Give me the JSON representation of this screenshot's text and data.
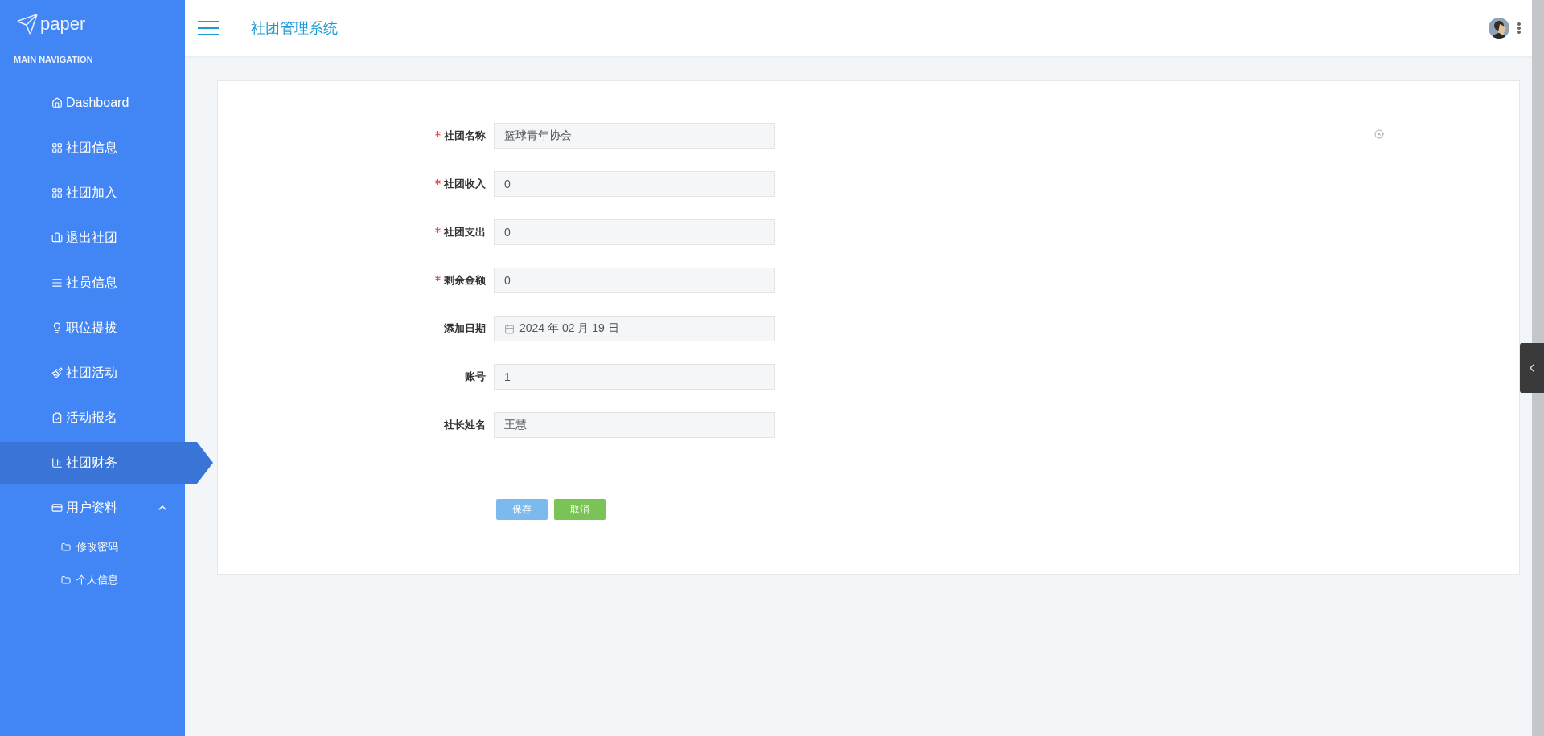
{
  "logo": {
    "text": "paper"
  },
  "sidebar": {
    "heading": "MAIN NAVIGATION",
    "items": [
      {
        "label": "Dashboard",
        "selected": false
      },
      {
        "label": "社团信息",
        "selected": false
      },
      {
        "label": "社团加入",
        "selected": false
      },
      {
        "label": "退出社团",
        "selected": false
      },
      {
        "label": "社员信息",
        "selected": false
      },
      {
        "label": "职位提拔",
        "selected": false
      },
      {
        "label": "社团活动",
        "selected": false
      },
      {
        "label": "活动报名",
        "selected": false
      },
      {
        "label": "社团财务",
        "selected": true
      },
      {
        "label": "用户资料",
        "selected": false,
        "expanded": true,
        "children": [
          {
            "label": "修改密码"
          },
          {
            "label": "个人信息"
          }
        ]
      }
    ]
  },
  "header": {
    "title": "社团管理系统"
  },
  "form": {
    "fields": [
      {
        "label": "社团名称",
        "required": true,
        "kind": "text",
        "value": "篮球青年协会"
      },
      {
        "label": "社团收入",
        "required": true,
        "kind": "text",
        "value": "0"
      },
      {
        "label": "社团支出",
        "required": true,
        "kind": "text",
        "value": "0"
      },
      {
        "label": "剩余金额",
        "required": true,
        "kind": "text",
        "value": "0"
      },
      {
        "label": "添加日期",
        "required": false,
        "kind": "date",
        "value": "2024 年 02 月 19 日"
      },
      {
        "label": "账号",
        "required": false,
        "kind": "text",
        "value": "1"
      },
      {
        "label": "社长姓名",
        "required": false,
        "kind": "text",
        "value": "王慧"
      }
    ],
    "buttons": [
      {
        "label": "保存",
        "kind": "primary"
      },
      {
        "label": "取消",
        "kind": "success"
      }
    ]
  }
}
